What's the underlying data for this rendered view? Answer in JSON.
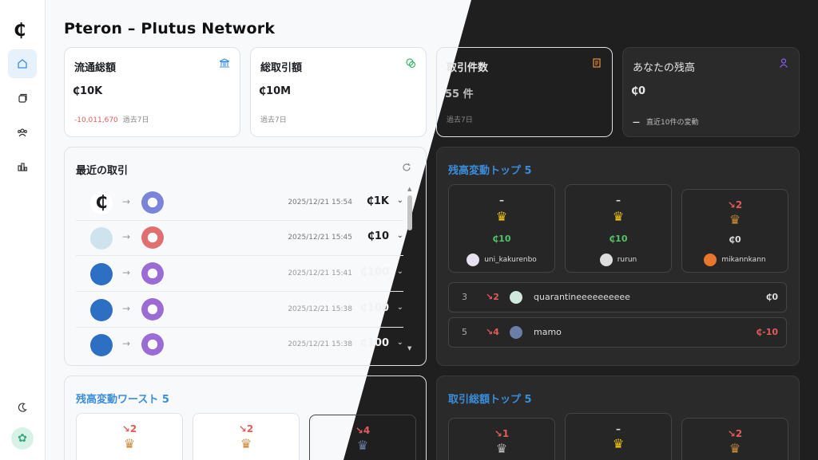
{
  "app": {
    "title": "Pteron – Plutus Network",
    "logo": "₵"
  },
  "sidebar": {
    "items": [
      {
        "icon": "home-icon",
        "active": true
      },
      {
        "icon": "cards-icon"
      },
      {
        "icon": "users-icon"
      },
      {
        "icon": "chart-icon"
      }
    ],
    "theme_icon": "moon-icon",
    "avatar_icon": "user-avatar"
  },
  "stats": [
    {
      "label": "流通総額",
      "value": "₵10K",
      "neg": "-10,011,670",
      "sub": "過去7日",
      "icon": "bank-icon",
      "color": "#3a8ddb"
    },
    {
      "label": "総取引額",
      "value": "₵10M",
      "neg": "",
      "sub": "過去7日",
      "icon": "coins-icon",
      "color": "#3bb56e"
    },
    {
      "label": "取引件数",
      "value": "55 件",
      "neg": "",
      "sub": "過去7日",
      "icon": "receipt-icon",
      "color": "#e8913a"
    },
    {
      "label": "あなたの残高",
      "value": "₵0",
      "neg": "—",
      "sub": "直近10件の変動",
      "icon": "person-icon",
      "color": "#8a5cf0"
    }
  ],
  "recent": {
    "title": "最近の取引",
    "rows": [
      {
        "time": "2025/12/21 15:54",
        "amount": "₵1K"
      },
      {
        "time": "2025/12/21 15:45",
        "amount": "₵10"
      },
      {
        "time": "2025/12/21 15:41",
        "amount": "₵100"
      },
      {
        "time": "2025/12/21 15:38",
        "amount": "₵100"
      },
      {
        "time": "2025/12/21 15:38",
        "amount": "₵100"
      }
    ]
  },
  "top_balance": {
    "title": "残高変動トップ 5",
    "podium": [
      {
        "change": "–",
        "balance": "₵10",
        "user": "uni_kakurenbo",
        "crown": "#f0c419",
        "bal_color": "#4fc46a"
      },
      {
        "change": "–",
        "balance": "₵10",
        "user": "rurun",
        "crown": "#f0c419",
        "bal_color": "#4fc46a"
      },
      {
        "change": "↘2",
        "balance": "₵0",
        "user": "mikannkann",
        "crown": "#c98a3a",
        "bal_color": "#ddd"
      }
    ],
    "list": [
      {
        "rank": "3",
        "change": "↘2",
        "user": "quarantineeeeeeeeee",
        "balance": "₵0"
      },
      {
        "rank": "5",
        "change": "↘4",
        "user": "mamo",
        "balance": "₵-10"
      }
    ]
  },
  "worst_balance": {
    "title": "残高変動ワースト 5",
    "podium": [
      {
        "change": "↘2"
      },
      {
        "change": "↘2"
      },
      {
        "change": "↘4"
      }
    ]
  },
  "top_volume": {
    "title": "取引総額トップ 5",
    "podium": [
      {
        "change": "↘1"
      },
      {
        "change": "–"
      },
      {
        "change": "↘2"
      }
    ]
  }
}
